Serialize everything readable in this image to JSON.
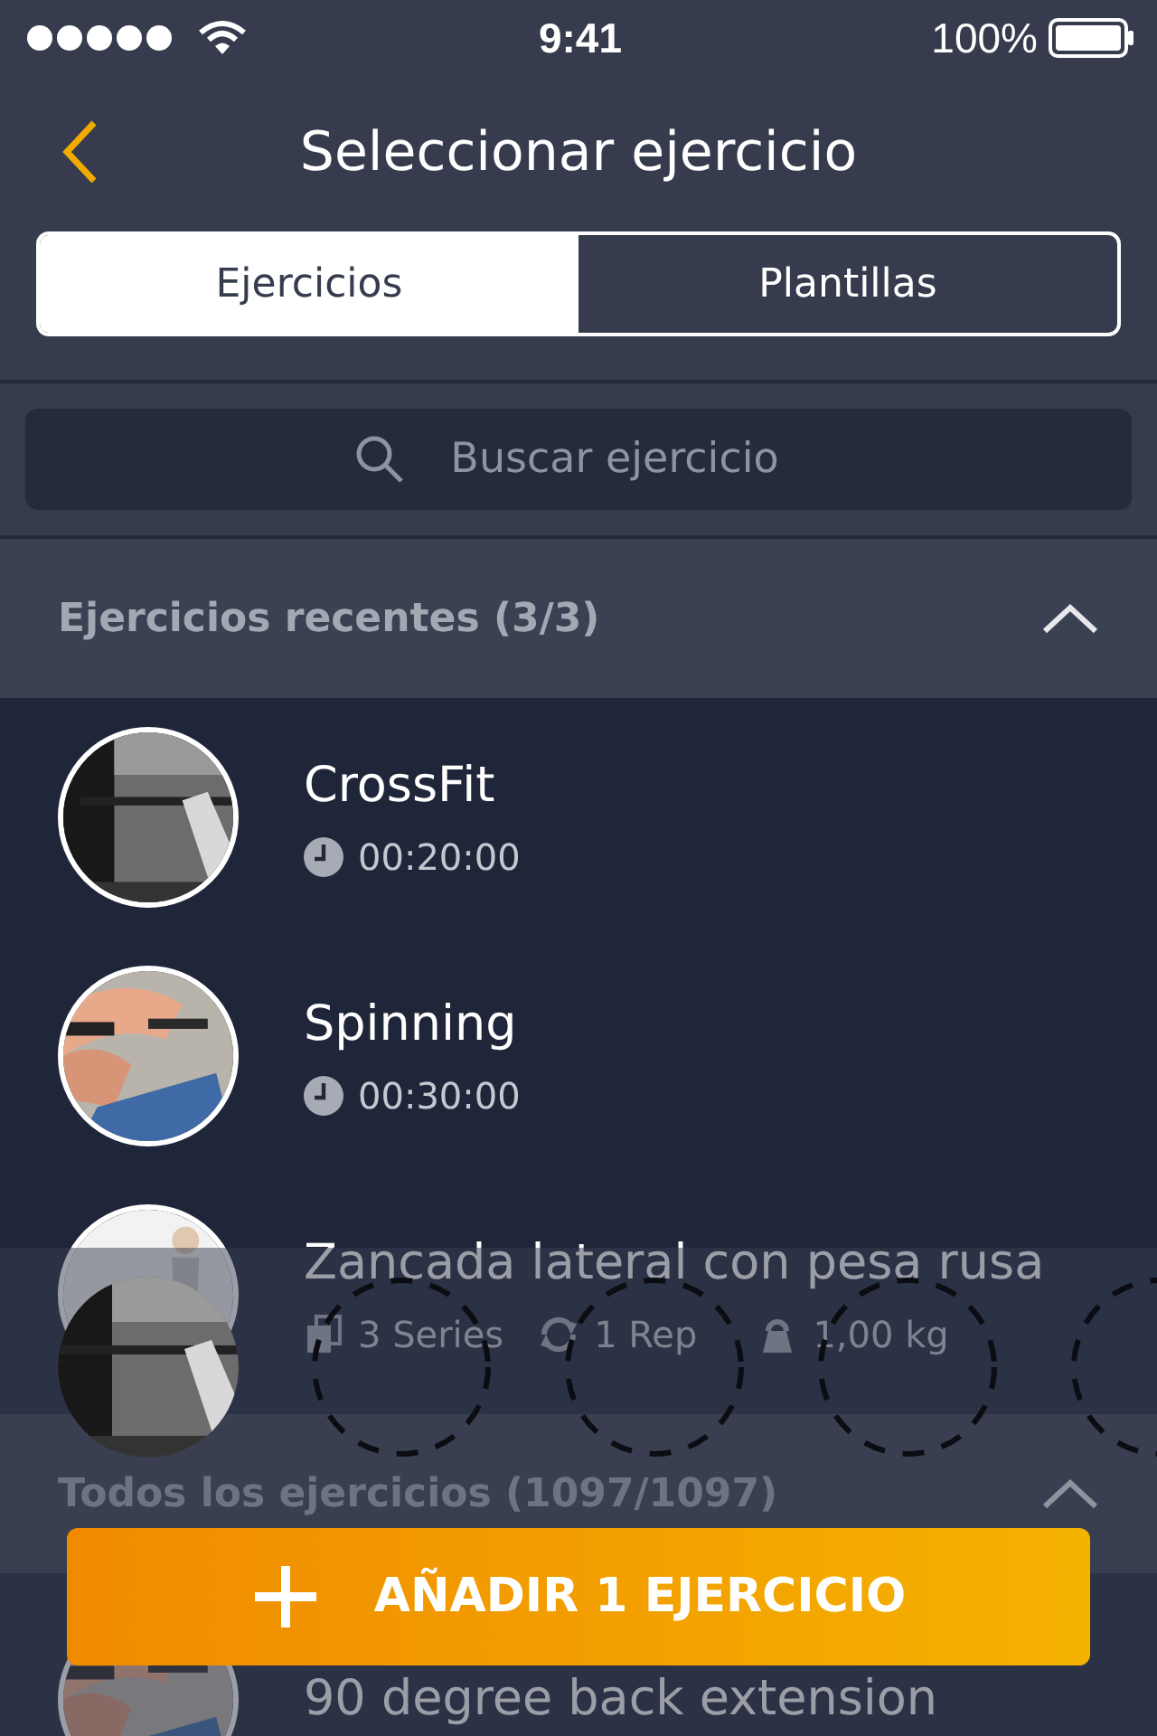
{
  "status_bar": {
    "time": "9:41",
    "battery": "100%"
  },
  "nav": {
    "title": "Seleccionar ejercicio"
  },
  "tabs": [
    {
      "label": "Ejercicios",
      "selected": true
    },
    {
      "label": "Plantillas",
      "selected": false
    }
  ],
  "search": {
    "placeholder": "Buscar ejercicio"
  },
  "sections": [
    {
      "title": "Ejercicios recentes (3/3)",
      "expanded": true,
      "items": [
        {
          "kind": "timed",
          "name": "CrossFit",
          "time": "00:20:00"
        },
        {
          "kind": "timed",
          "name": "Spinning",
          "time": "00:30:00"
        },
        {
          "kind": "strength",
          "name": "Zancada lateral con pesa rusa",
          "series": "3 Series",
          "reps": "1 Rep",
          "weight": "1,00 kg"
        }
      ]
    },
    {
      "title": "Todos los ejercicios (1097/1097)",
      "expanded": true,
      "items": [
        {
          "kind": "plain",
          "name": "90 degree back extension"
        }
      ]
    }
  ],
  "selection": {
    "slots": [
      {
        "filled": true
      },
      {
        "filled": false
      },
      {
        "filled": false
      },
      {
        "filled": false
      },
      {
        "filled": false
      }
    ]
  },
  "add_button": {
    "label": "AÑADIR 1 EJERCICIO"
  }
}
